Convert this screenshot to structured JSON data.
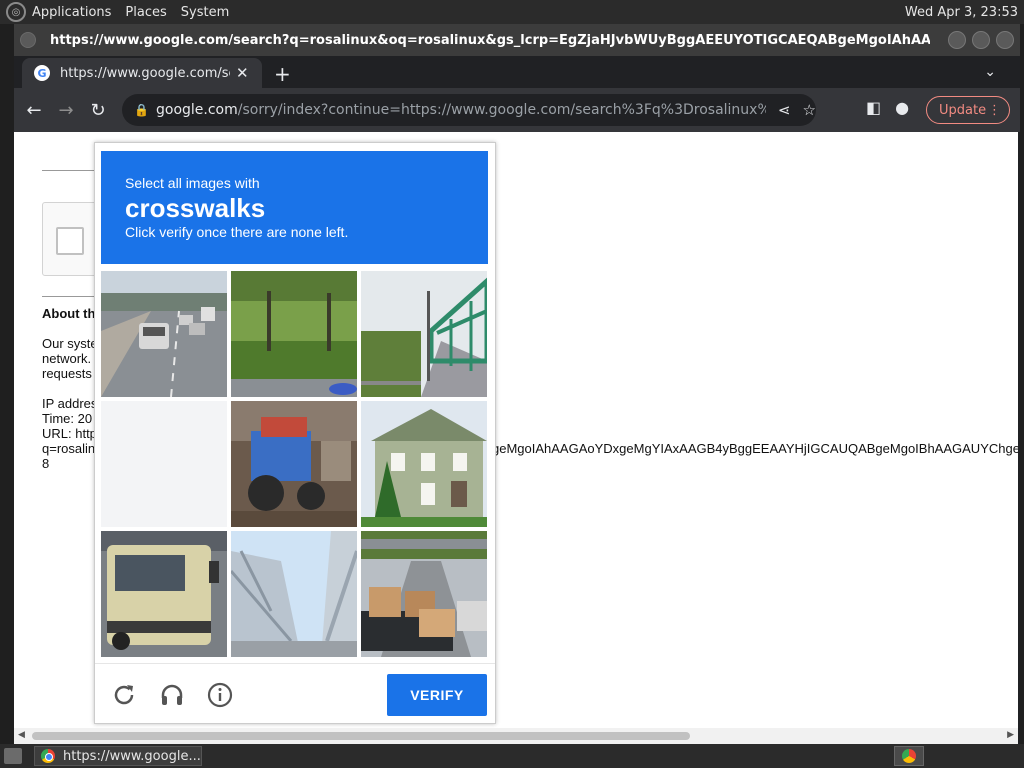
{
  "desktop": {
    "menus": [
      "Applications",
      "Places",
      "System"
    ],
    "clock": "Wed Apr  3, 23:53"
  },
  "window": {
    "title": "https://www.google.com/search?q=rosalinux&oq=rosalinux&gs_lcrp=EgZjaHJvbWUyBggAEEUYOTIGCAEQABgeMgoIAhAAGAoYDxgeMgYI..."
  },
  "tabs": [
    {
      "title": "https://www.google.com/search",
      "active": true
    }
  ],
  "toolbar": {
    "url_host": "google.com",
    "url_rest": "/sorry/index?continue=https://www.google.com/search%3Fq%3Drosalinux%26oq%3...",
    "update_label": "Update"
  },
  "page": {
    "about_heading": "About th",
    "para_lines": [
      "Our syste",
      "network.",
      "requests"
    ],
    "info_lines": [
      "IP addres",
      "Time: 20",
      "URL: http",
      "q=rosalin",
      "8"
    ],
    "url_overflow": "geMgoIAhAAGAoYDxgeMgYIAxAAGB4yBggEEAAYHjIGCAUQABgeMgoIBhAAGAUYChge"
  },
  "captcha": {
    "instruction_top": "Select all images with",
    "target": "crosswalks",
    "instruction_bottom": "Click verify once there are none left.",
    "verify_label": "VERIFY",
    "tiles": [
      {
        "label": "highway-with-cars"
      },
      {
        "label": "grassy-roadside"
      },
      {
        "label": "green-bridge-road"
      },
      {
        "label": "blank-loading"
      },
      {
        "label": "tractor"
      },
      {
        "label": "green-house"
      },
      {
        "label": "truck"
      },
      {
        "label": "steel-bridge"
      },
      {
        "label": "pickup-truck-boxes"
      }
    ]
  },
  "taskbar": {
    "task_label": "https://www.google..."
  }
}
